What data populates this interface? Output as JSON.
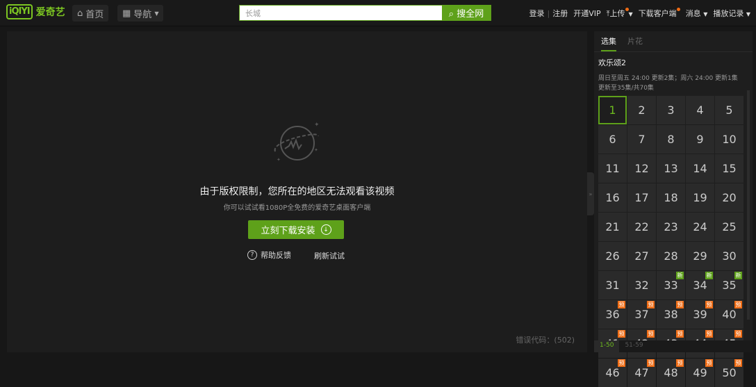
{
  "header": {
    "logo_mark": "iQIYI",
    "logo_text": "爱奇艺",
    "home": "首页",
    "nav": "导航",
    "search_value": "长城",
    "search_button": "搜全网",
    "links": {
      "login": "登录",
      "sep": "|",
      "register": "注册",
      "vip": "开通VIP",
      "upload": "上传",
      "client": "下载客户端",
      "messages": "消息",
      "history": "播放记录"
    }
  },
  "player": {
    "title": "由于版权限制，您所在的地区无法观看该视频",
    "subtitle": "你可以试试看1080P全免费的爱奇艺桌面客户端",
    "download_button": "立刻下载安装",
    "help": "帮助反馈",
    "refresh": "刷新试试",
    "error_code": "错误代码：(502)"
  },
  "sidebar": {
    "tabs": [
      "选集",
      "片花"
    ],
    "show_title": "欢乐颂2",
    "schedule": "周日至周五 24:00 更新2集；周六 24:00 更新1集",
    "progress": "更新至35集/共70集",
    "current_episode": 1,
    "new_badge": "新",
    "preview_badge": "预",
    "new_episodes": [
      33,
      34,
      35
    ],
    "preview_from": 36,
    "episode_count": 50,
    "pages": [
      "1-50",
      "51-59"
    ],
    "accent": "#5ea11a",
    "preview_color": "#f06c14"
  }
}
